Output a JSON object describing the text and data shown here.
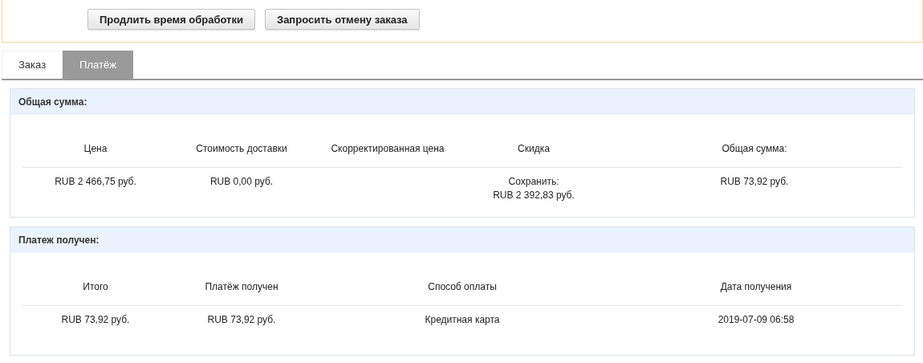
{
  "actions": [
    {
      "label": "Продлить время обработки"
    },
    {
      "label": "Запросить отмену заказа"
    }
  ],
  "tabs": [
    {
      "label": "Заказ",
      "selected": false
    },
    {
      "label": "Платёж",
      "selected": true
    }
  ],
  "panels": [
    {
      "title": "Общая сумма:",
      "columns": [
        "Цена",
        "Стоимость доставки",
        "Скорректированная цена",
        "Скидка",
        "Общая сумма:"
      ],
      "rows": [
        [
          "RUB 2 466,75 руб.",
          "RUB 0,00 руб.",
          "",
          "Сохранить:\nRUB 2 392,83 руб.",
          "RUB 73,92 руб."
        ]
      ]
    },
    {
      "title": "Платеж получен:",
      "columns": [
        "Итого",
        "Платёж получен",
        "Способ оплаты",
        "Дата получения"
      ],
      "rows": [
        [
          "RUB 73,92 руб.",
          "RUB 73,92 руб.",
          "Кредитная карта",
          "2019-07-09 06:58"
        ]
      ]
    }
  ]
}
